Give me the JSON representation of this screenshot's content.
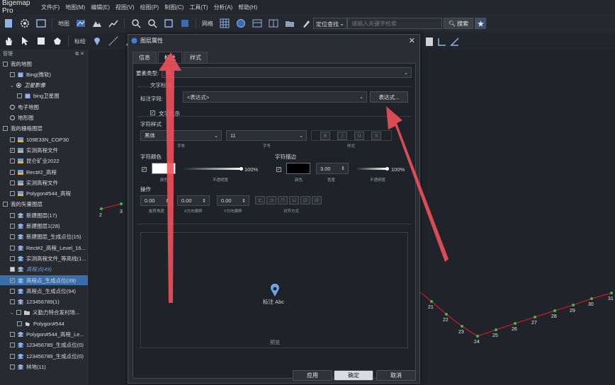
{
  "app": {
    "title": "Bigemap Pro",
    "menus": [
      "文件(F)",
      "地图(M)",
      "编辑(E)",
      "视图(V)",
      "绘图(P)",
      "制图(C)",
      "工具(T)",
      "分析(A)",
      "帮助(H)"
    ]
  },
  "toolbar": {
    "map_label": "地图",
    "grid_label": "网格",
    "locate_label": "定位查找",
    "search_placeholder": "请输入关键字检索",
    "search_button": "搜索"
  },
  "toolbar2": {
    "annotate_label": "标绘"
  },
  "left_panel": {
    "header": "管理",
    "items": [
      {
        "label": "我的地图",
        "indent": 0,
        "type": "checkbox"
      },
      {
        "label": "Bing(微软)",
        "indent": 1,
        "type": "checkbox",
        "icon": "book-icon"
      },
      {
        "label": "卫星影像",
        "indent": 1,
        "type": "radio-on",
        "style": "italic-white"
      },
      {
        "label": "bing卫星图",
        "indent": 2,
        "type": "checkbox",
        "icon": "book-icon"
      },
      {
        "label": "电子地图",
        "indent": 1,
        "type": "radio"
      },
      {
        "label": "地形图",
        "indent": 1,
        "type": "radio"
      },
      {
        "label": "我的栅格图层",
        "indent": 0,
        "type": "checkbox"
      },
      {
        "label": "109E33N_COP30",
        "indent": 1,
        "type": "checkbox",
        "icon": "raster-icon"
      },
      {
        "label": "实测高程文件",
        "indent": 1,
        "type": "checked",
        "icon": "raster-icon"
      },
      {
        "label": "昆仑矿业2022",
        "indent": 1,
        "type": "checkbox",
        "icon": "raster-icon"
      },
      {
        "label": "Rect#2_高程",
        "indent": 1,
        "type": "checkbox",
        "icon": "raster-icon"
      },
      {
        "label": "实测高程文件",
        "indent": 1,
        "type": "checkbox",
        "icon": "raster-icon"
      },
      {
        "label": "Polygon#544_高程",
        "indent": 1,
        "type": "checkbox",
        "icon": "raster-icon"
      },
      {
        "label": "我的矢量图层",
        "indent": 0,
        "type": "checkbox"
      },
      {
        "label": "新建图层(17)",
        "indent": 1,
        "type": "checkbox",
        "icon": "layers-icon"
      },
      {
        "label": "新建图层1(28)",
        "indent": 1,
        "type": "checkbox",
        "icon": "layers-icon"
      },
      {
        "label": "新建图层_生成点位(15)",
        "indent": 1,
        "type": "checkbox",
        "icon": "layers-icon"
      },
      {
        "label": "Rect#2_高程_Level_16...",
        "indent": 1,
        "type": "checkbox",
        "icon": "layers-icon"
      },
      {
        "label": "实测高程文件_等高线(1...",
        "indent": 1,
        "type": "checkbox",
        "icon": "layers-icon"
      },
      {
        "label": "高程点(49)",
        "indent": 1,
        "type": "filled",
        "icon": "layers-icon",
        "style": "italic-blue"
      },
      {
        "label": "高程点_生成点位(39)",
        "indent": 1,
        "type": "checked",
        "icon": "layers-icon",
        "selected": true
      },
      {
        "label": "高程点_生成点位(94)",
        "indent": 1,
        "type": "checkbox",
        "icon": "layers-icon"
      },
      {
        "label": "123456789(1)",
        "indent": 1,
        "type": "checkbox",
        "icon": "layers-icon"
      },
      {
        "label": "义勤力特合发村场...",
        "indent": 1,
        "type": "checkbox",
        "icon": "folder-icon",
        "expand": true
      },
      {
        "label": "Polygon#544",
        "indent": 2,
        "type": "checkbox",
        "icon": "polygon-icon"
      },
      {
        "label": "Polygon#544_高程_Le...",
        "indent": 1,
        "type": "checkbox",
        "icon": "layers-icon"
      },
      {
        "label": "123456789_生成点位(0)",
        "indent": 1,
        "type": "checkbox",
        "icon": "layers-icon"
      },
      {
        "label": "123456789_生成点位(0)",
        "indent": 1,
        "type": "checkbox",
        "icon": "layers-icon"
      },
      {
        "label": "林地(11)",
        "indent": 1,
        "type": "checkbox",
        "icon": "layers-icon"
      }
    ]
  },
  "dialog": {
    "title": "图层属性",
    "tabs": [
      "信息",
      "标注",
      "样式"
    ],
    "active_tab": 1,
    "feature_type_label": "要素类型:",
    "feature_type_value": "点",
    "text_label_section": "文字标注",
    "label_field_label": "标注字段:",
    "label_field_value": "<表达式>",
    "expression_button": "表达式...",
    "text_display_label": "文字显示",
    "font_style_label": "字符样式",
    "font_value": "黑体",
    "font_sub": "字体",
    "size_value": "11",
    "size_sub": "字号",
    "style_sub": "样式",
    "char_color_label": "字符颜色",
    "color_sub": "颜色",
    "opacity_sub": "不透明度",
    "opacity_value": "100%",
    "stroke_label": "字符描边",
    "stroke_width": "3.00",
    "stroke_width_sub": "宽度",
    "stroke_opacity_value": "100%",
    "stroke_color_sub": "颜色",
    "stroke_opacity_sub": "不透明度",
    "operation_label": "操作",
    "rotation_value": "0.00",
    "rotation_sub": "旋转角度",
    "x_offset_value": "0.00",
    "x_offset_sub": "X方向偏移",
    "y_offset_value": "0.00",
    "y_offset_sub": "Y方向偏移",
    "align_sub": "对齐方式",
    "preview_label": "标注 Abc",
    "preview_caption": "预览",
    "apply_button": "应用",
    "ok_button": "确定",
    "cancel_button": "取消"
  },
  "map": {
    "point_labels": [
      "2",
      "3",
      "21",
      "22",
      "23",
      "24",
      "25",
      "26",
      "27",
      "28",
      "29",
      "30",
      "31"
    ],
    "colors": {
      "line": "#c0192c",
      "point": "#36c23a",
      "arrow": "#f0505a"
    }
  }
}
